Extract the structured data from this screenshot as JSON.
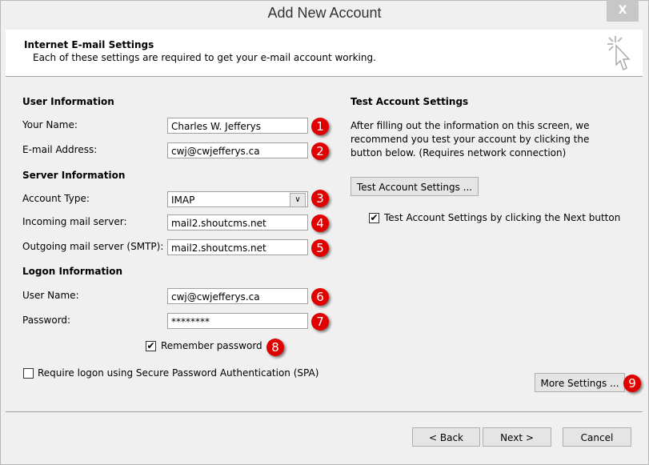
{
  "window": {
    "title": "Add New Account",
    "close_label": "X"
  },
  "header": {
    "title": "Internet E-mail Settings",
    "subtitle": "Each of these settings are required to get your e-mail account working."
  },
  "user_info": {
    "heading": "User Information",
    "name_label": "Your Name:",
    "name_value": "Charles W. Jefferys",
    "email_label": "E-mail Address:",
    "email_value": "cwj@cwjefferys.ca"
  },
  "server_info": {
    "heading": "Server Information",
    "type_label": "Account Type:",
    "type_value": "IMAP",
    "incoming_label": "Incoming mail server:",
    "incoming_value": "mail2.shoutcms.net",
    "outgoing_label": "Outgoing mail server (SMTP):",
    "outgoing_value": "mail2.shoutcms.net"
  },
  "logon_info": {
    "heading": "Logon Information",
    "user_label": "User Name:",
    "user_value": "cwj@cwjefferys.ca",
    "password_label": "Password:",
    "password_value": "********",
    "remember_label": "Remember password",
    "remember_checked": true,
    "spa_label": "Require logon using Secure Password Authentication (SPA)",
    "spa_checked": false
  },
  "test": {
    "heading": "Test Account Settings",
    "description": "After filling out the information on this screen, we recommend you test your account by clicking the button below. (Requires network connection)",
    "button": "Test Account Settings ...",
    "next_label": "Test Account Settings by clicking the Next button",
    "next_checked": true
  },
  "more_settings": "More Settings ...",
  "footer": {
    "back": "< Back",
    "next": "Next >",
    "cancel": "Cancel"
  },
  "badges": [
    "1",
    "2",
    "3",
    "4",
    "5",
    "6",
    "7",
    "8",
    "9"
  ],
  "colors": {
    "badge": "#e00000"
  }
}
